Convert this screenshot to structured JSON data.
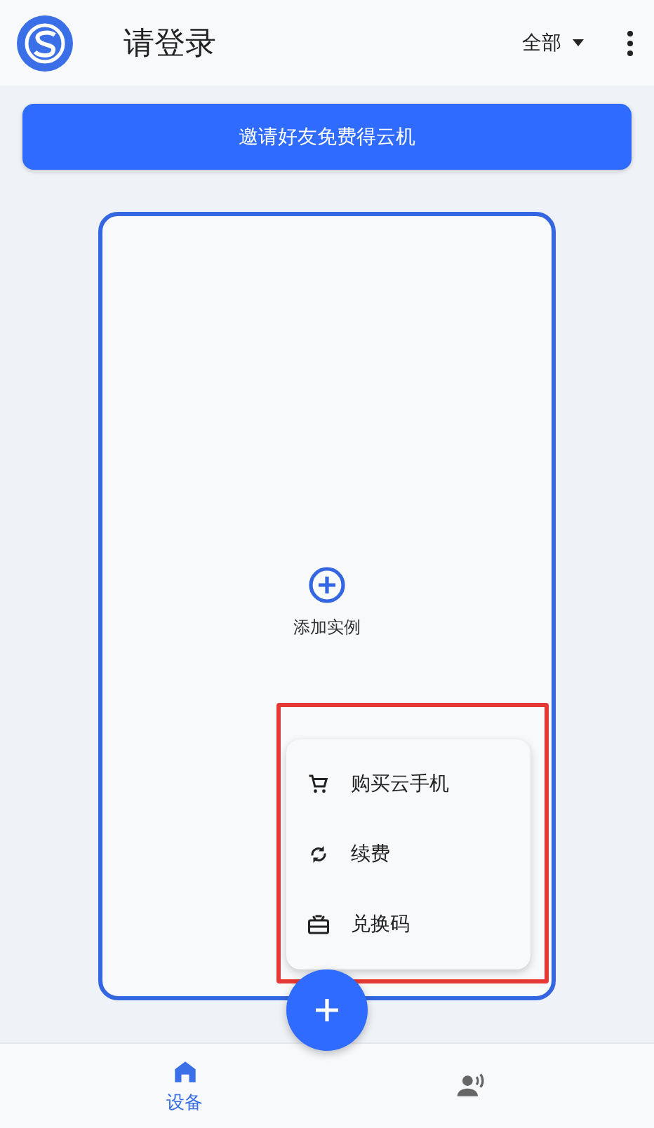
{
  "header": {
    "title": "请登录",
    "filter": "全部"
  },
  "invite_button": {
    "label": "邀请好友免费得云机"
  },
  "instance_card": {
    "add_label": "添加实例"
  },
  "menu": {
    "items": [
      {
        "kind": "cart",
        "label": "购买云手机"
      },
      {
        "kind": "renew",
        "label": "续费"
      },
      {
        "kind": "gift",
        "label": "兑换码"
      }
    ]
  },
  "highlight": {
    "color": "#e53935"
  },
  "bottom_nav": {
    "tabs": [
      {
        "kind": "home",
        "label": "设备",
        "selected": true
      },
      {
        "kind": "speaker",
        "selected": false
      }
    ]
  }
}
